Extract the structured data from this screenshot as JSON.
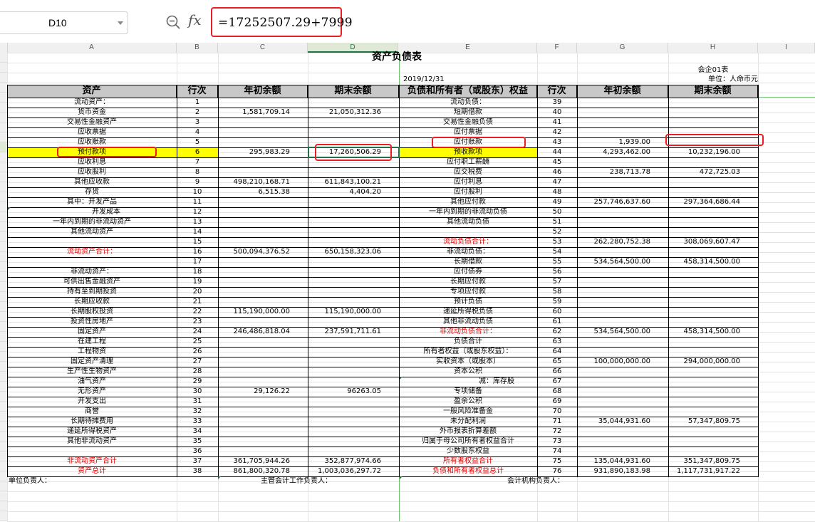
{
  "formula_bar": {
    "name_box": "D10",
    "zoom_icon": "zoom-search-icon",
    "fx_label": "fx",
    "formula": "=17252507.29+7999"
  },
  "columns": [
    "A",
    "B",
    "C",
    "D",
    "E",
    "F",
    "G",
    "H",
    "I"
  ],
  "selected_column": "D",
  "sheet": {
    "title": "资产负债表",
    "form_code": "会企01表",
    "date": "2019/12/31",
    "unit": "单位：人命币元",
    "headers": {
      "left": [
        "资产",
        "行次",
        "年初余额",
        "期末余额"
      ],
      "right": [
        "负债和所有者（或股东）权益",
        "行次",
        "年初余额",
        "期末余额"
      ]
    },
    "rows": [
      {
        "a": "流动资产：",
        "b": "1",
        "c": "",
        "d": "",
        "e": "流动负债：",
        "f": "39",
        "g": "",
        "h": ""
      },
      {
        "a": "货币资金",
        "b": "2",
        "c": "1,581,709.14",
        "d": "21,050,312.36",
        "e": "短期借款",
        "f": "40",
        "g": "",
        "h": ""
      },
      {
        "a": "交易性金融资产",
        "b": "3",
        "c": "",
        "d": "",
        "e": "交易性金融负债",
        "f": "41",
        "g": "",
        "h": ""
      },
      {
        "a": "应收票据",
        "b": "4",
        "c": "",
        "d": "",
        "e": "应付票据",
        "f": "42",
        "g": "",
        "h": ""
      },
      {
        "a": "应收账款",
        "b": "5",
        "c": "",
        "d": "",
        "e": "应付账款",
        "f": "43",
        "g": "1,939.00",
        "h": ""
      },
      {
        "a": "预付款项",
        "b": "6",
        "c": "295,983.29",
        "d": "17,260,506.29",
        "e": "预收款项",
        "f": "44",
        "g": "4,293,462.00",
        "h": "10,232,196.00"
      },
      {
        "a": "应收利息",
        "b": "7",
        "c": "",
        "d": "",
        "e": "应付职工薪酬",
        "f": "45",
        "g": "",
        "h": ""
      },
      {
        "a": "应收股利",
        "b": "8",
        "c": "",
        "d": "",
        "e": "应交税费",
        "f": "46",
        "g": "238,713.78",
        "h": "472,725.03"
      },
      {
        "a": "其他应收款",
        "b": "9",
        "c": "498,210,168.71",
        "d": "611,843,100.21",
        "e": "应付利息",
        "f": "47",
        "g": "",
        "h": ""
      },
      {
        "a": "存货",
        "b": "10",
        "c": "6,515.38",
        "d": "4,404.20",
        "e": "应付股利",
        "f": "48",
        "g": "",
        "h": ""
      },
      {
        "a": "其中：开发产品",
        "b": "11",
        "c": "",
        "d": "",
        "e": "其他应付款",
        "f": "49",
        "g": "257,746,637.60",
        "h": "297,364,686.44"
      },
      {
        "a": "开发成本",
        "b": "12",
        "c": "",
        "d": "",
        "e": "一年内到期的非流动负债",
        "f": "50",
        "g": "",
        "h": ""
      },
      {
        "a": "一年内到期的非流动资产",
        "b": "13",
        "c": "",
        "d": "",
        "e": "其他流动负债",
        "f": "51",
        "g": "",
        "h": ""
      },
      {
        "a": "其他流动资产",
        "b": "14",
        "c": "",
        "d": "",
        "e": "",
        "f": "52",
        "g": "",
        "h": ""
      },
      {
        "a": "",
        "b": "15",
        "c": "",
        "d": "",
        "e": "流动负债合计：",
        "f": "53",
        "g": "262,280,752.38",
        "h": "308,069,607.47"
      },
      {
        "a": "流动资产合计：",
        "b": "16",
        "c": "500,094,376.52",
        "d": "650,158,323.06",
        "e": "非流动负债：",
        "f": "54",
        "g": "",
        "h": ""
      },
      {
        "a": "",
        "b": "17",
        "c": "",
        "d": "",
        "e": "长期借款",
        "f": "55",
        "g": "534,564,500.00",
        "h": "458,314,500.00"
      },
      {
        "a": "非流动资产：",
        "b": "18",
        "c": "",
        "d": "",
        "e": "应付债券",
        "f": "56",
        "g": "",
        "h": ""
      },
      {
        "a": "可供出售金融资产",
        "b": "19",
        "c": "",
        "d": "",
        "e": "长期应付款",
        "f": "57",
        "g": "",
        "h": ""
      },
      {
        "a": "持有至到期投资",
        "b": "20",
        "c": "",
        "d": "",
        "e": "专项应付款",
        "f": "58",
        "g": "",
        "h": ""
      },
      {
        "a": "长期应收款",
        "b": "21",
        "c": "",
        "d": "",
        "e": "预计负债",
        "f": "59",
        "g": "",
        "h": ""
      },
      {
        "a": "长期股权投资",
        "b": "22",
        "c": "115,190,000.00",
        "d": "115,190,000.00",
        "e": "递延所得税负债",
        "f": "60",
        "g": "",
        "h": ""
      },
      {
        "a": "投资性房地产",
        "b": "23",
        "c": "",
        "d": "",
        "e": "其他非流动负债",
        "f": "61",
        "g": "",
        "h": ""
      },
      {
        "a": "固定资产",
        "b": "24",
        "c": "246,486,818.04",
        "d": "237,591,711.61",
        "e": "非流动负债合计：",
        "f": "62",
        "g": "534,564,500.00",
        "h": "458,314,500.00"
      },
      {
        "a": "在建工程",
        "b": "25",
        "c": "",
        "d": "",
        "e": "负债合计",
        "f": "63",
        "g": "",
        "h": ""
      },
      {
        "a": "工程物资",
        "b": "26",
        "c": "",
        "d": "",
        "e": "所有者权益（或股东权益）：",
        "f": "64",
        "g": "",
        "h": ""
      },
      {
        "a": "固定资产清理",
        "b": "27",
        "c": "",
        "d": "",
        "e": "实收资本（或股本）",
        "f": "65",
        "g": "100,000,000.00",
        "h": "294,000,000.00"
      },
      {
        "a": "生产性生物资产",
        "b": "28",
        "c": "",
        "d": "",
        "e": "资本公积",
        "f": "66",
        "g": "",
        "h": ""
      },
      {
        "a": "油气资产",
        "b": "29",
        "c": "",
        "d": "",
        "e": "减：库存股",
        "f": "67",
        "g": "",
        "h": ""
      },
      {
        "a": "无形资产",
        "b": "30",
        "c": "29,126.22",
        "d": "96263.05",
        "e": "专项储备",
        "f": "68",
        "g": "",
        "h": ""
      },
      {
        "a": "开发支出",
        "b": "31",
        "c": "",
        "d": "",
        "e": "盈余公积",
        "f": "69",
        "g": "",
        "h": ""
      },
      {
        "a": "商誉",
        "b": "32",
        "c": "",
        "d": "",
        "e": "一般风险准备金",
        "f": "70",
        "g": "",
        "h": ""
      },
      {
        "a": "长期待摊费用",
        "b": "33",
        "c": "",
        "d": "",
        "e": "未分配利润",
        "f": "71",
        "g": "35,044,931.60",
        "h": "57,347,809.75"
      },
      {
        "a": "递延所得税资产",
        "b": "34",
        "c": "",
        "d": "",
        "e": "外币报表折算差额",
        "f": "72",
        "g": "",
        "h": ""
      },
      {
        "a": "其他非流动资产",
        "b": "35",
        "c": "",
        "d": "",
        "e": "归属于母公司所有者权益合计",
        "f": "73",
        "g": "",
        "h": ""
      },
      {
        "a": "",
        "b": "36",
        "c": "",
        "d": "",
        "e": "少数股东权益",
        "f": "74",
        "g": "",
        "h": ""
      },
      {
        "a": "非流动资产合计",
        "b": "37",
        "c": "361,705,944.26",
        "d": "352,877,974.66",
        "e": "所有者权益合计",
        "f": "75",
        "g": "135,044,931.60",
        "h": "351,347,809.75"
      },
      {
        "a": "资产总计",
        "b": "38",
        "c": "861,800,320.78",
        "d": "1,003,036,297.72",
        "e": "负债和所有者权益总计",
        "f": "76",
        "g": "931,890,183.98",
        "h": "1,117,731,917.22"
      }
    ],
    "red_a_rows": [
      15,
      36,
      37
    ],
    "red_e_rows": [
      14,
      23,
      36,
      37
    ],
    "highlight_row": 5,
    "highlight_color": "#ffff00",
    "accent_red": "#ec1c24",
    "selection_green": "#217346",
    "footer": {
      "unit_head": "单位负责人：",
      "accounting_head": "主管会计工作负责人：",
      "agency_head": "会计机构负责人："
    }
  }
}
